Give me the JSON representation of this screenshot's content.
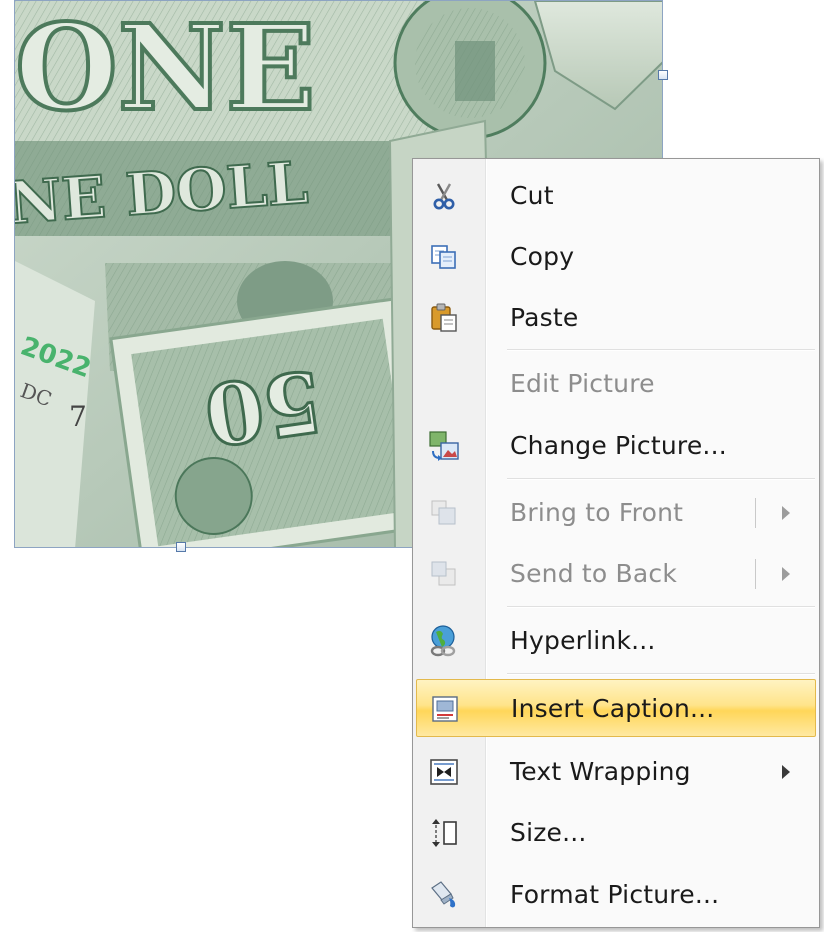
{
  "menu": {
    "items": [
      {
        "id": "cut",
        "label": "Cut",
        "icon": "scissors-icon",
        "enabled": true
      },
      {
        "id": "copy",
        "label": "Copy",
        "icon": "copy-icon",
        "enabled": true
      },
      {
        "id": "paste",
        "label": "Paste",
        "icon": "paste-icon",
        "enabled": true
      },
      {
        "id": "edit_picture",
        "label": "Edit Picture",
        "icon": "",
        "enabled": false
      },
      {
        "id": "change_picture",
        "label": "Change Picture...",
        "icon": "change-picture-icon",
        "enabled": true
      },
      {
        "id": "bring_to_front",
        "label": "Bring to Front",
        "icon": "bring-to-front-icon",
        "enabled": false,
        "submenu": true
      },
      {
        "id": "send_to_back",
        "label": "Send to Back",
        "icon": "send-to-back-icon",
        "enabled": false,
        "submenu": true
      },
      {
        "id": "hyperlink",
        "label": "Hyperlink...",
        "icon": "hyperlink-globe-icon",
        "enabled": true
      },
      {
        "id": "insert_caption",
        "label": "Insert Caption...",
        "icon": "insert-caption-icon",
        "enabled": true,
        "highlighted": true
      },
      {
        "id": "text_wrapping",
        "label": "Text Wrapping",
        "icon": "text-wrapping-icon",
        "enabled": true,
        "submenu": true
      },
      {
        "id": "size",
        "label": "Size...",
        "icon": "size-icon",
        "enabled": true
      },
      {
        "id": "format_picture",
        "label": "Format Picture...",
        "icon": "format-picture-icon",
        "enabled": true
      }
    ]
  },
  "colors": {
    "highlight_top": "#fff3c2",
    "highlight_bottom": "#ffd659",
    "highlight_border": "#e3b94c",
    "disabled_text": "#8d8d8d",
    "selection_border": "#8da4c2"
  }
}
